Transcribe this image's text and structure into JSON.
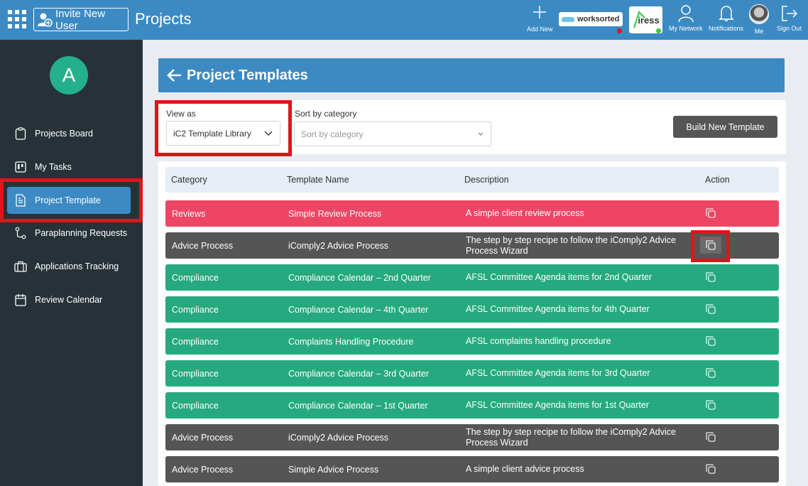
{
  "topbar": {
    "invite_label": "Invite New User",
    "app_title": "Projects",
    "add_new_label": "Add New",
    "worksorted_label": "worksorted",
    "iress_label": "iress",
    "network_label": "My Network",
    "notifications_label": "Notifications",
    "me_label": "Me",
    "signout_label": "Sign Out",
    "worksorted_status_color": "#e3121b",
    "iress_status_color": "#2ecc40"
  },
  "sidebar": {
    "avatar_letter": "A",
    "items": [
      {
        "label": "Projects Board",
        "icon": "clipboard-icon"
      },
      {
        "label": "My Tasks",
        "icon": "kanban-icon"
      },
      {
        "label": "Project Template",
        "icon": "document-icon",
        "active": true
      },
      {
        "label": "Paraplanning Requests",
        "icon": "workflow-icon"
      },
      {
        "label": "Applications Tracking",
        "icon": "briefcase-icon"
      },
      {
        "label": "Review Calendar",
        "icon": "calendar-icon"
      }
    ]
  },
  "main": {
    "page_title": "Project Templates",
    "view_as_label": "View as",
    "view_as_value": "iC2 Template Library",
    "sort_label": "Sort by category",
    "sort_placeholder": "Sort by category",
    "build_button": "Build New Template"
  },
  "table": {
    "headers": [
      "Category",
      "Template Name",
      "Description",
      "Action"
    ],
    "rows": [
      {
        "category": "Reviews",
        "name": "Simple Review Process",
        "description": "A simple client review process",
        "color": "#ef4565"
      },
      {
        "category": "Advice Process",
        "name": "iComply2 Advice Process",
        "description": "The step by step recipe to follow the iComply2 Advice Process Wizard",
        "color": "#555555"
      },
      {
        "category": "Compliance",
        "name": "Compliance Calendar – 2nd Quarter",
        "description": "AFSL Committee Agenda items for 2nd Quarter",
        "color": "#26a97f"
      },
      {
        "category": "Compliance",
        "name": "Compliance Calendar – 4th Quarter",
        "description": "AFSL Committee Agenda items for 4th Quarter",
        "color": "#26a97f"
      },
      {
        "category": "Compliance",
        "name": "Complaints Handling Procedure",
        "description": "AFSL complaints handling procedure",
        "color": "#26a97f"
      },
      {
        "category": "Compliance",
        "name": "Compliance Calendar – 3rd Quarter",
        "description": "AFSL Committee Agenda items for 3rd Quarter",
        "color": "#26a97f"
      },
      {
        "category": "Compliance",
        "name": "Compliance Calendar – 1st Quarter",
        "description": "AFSL Committee Agenda items for 1st Quarter",
        "color": "#26a97f"
      },
      {
        "category": "Advice Process",
        "name": "iComply2 Advice Process",
        "description": "The step by step recipe to follow the iComply2 Advice Process Wizard",
        "color": "#555555"
      },
      {
        "category": "Advice Process",
        "name": "Simple Advice Process",
        "description": "A simple client advice process",
        "color": "#555555"
      }
    ]
  }
}
